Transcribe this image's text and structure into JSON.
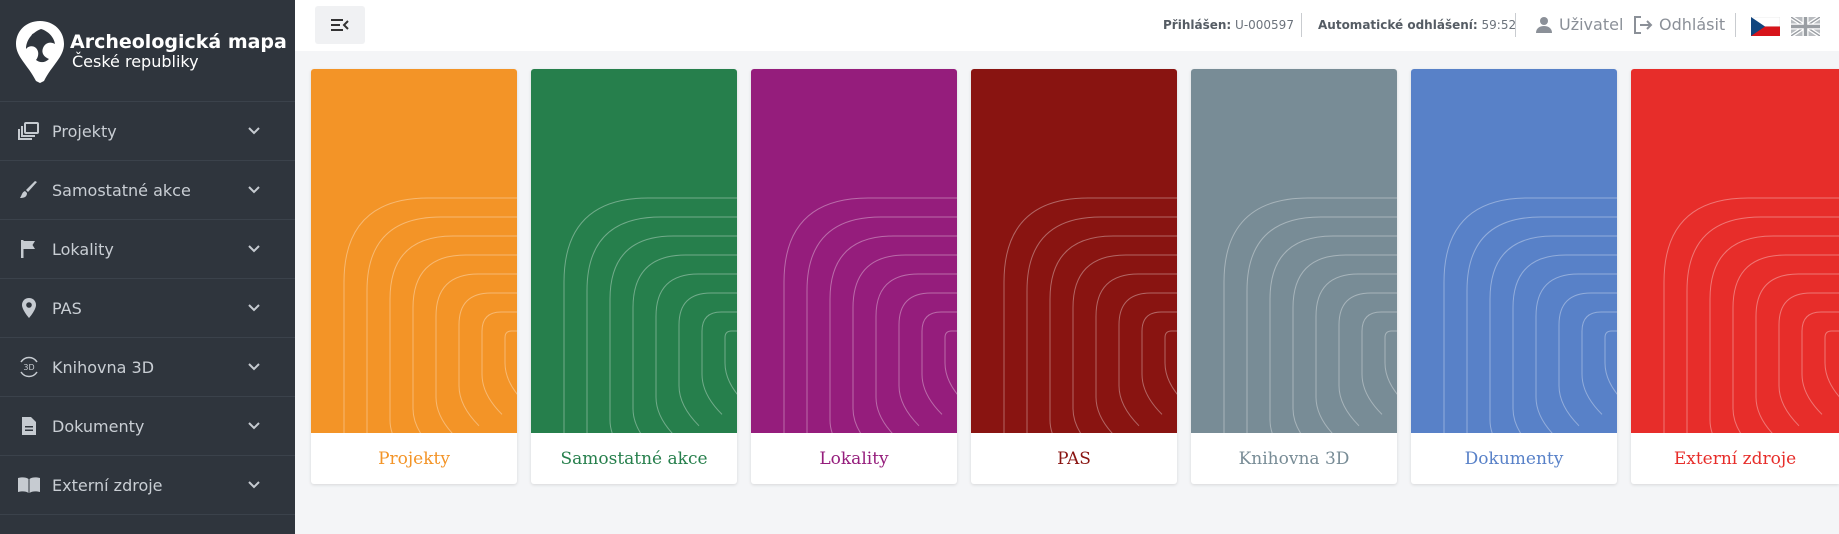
{
  "brand": {
    "title": "Archeologická mapa",
    "subtitle": "České republiky"
  },
  "sidebar": {
    "items": [
      {
        "label": "Projekty",
        "icon": "projects-icon"
      },
      {
        "label": "Samostatné akce",
        "icon": "brush-icon"
      },
      {
        "label": "Lokality",
        "icon": "flag-icon"
      },
      {
        "label": "PAS",
        "icon": "map-pin-icon"
      },
      {
        "label": "Knihovna 3D",
        "icon": "3d-rotate-icon"
      },
      {
        "label": "Dokumenty",
        "icon": "document-icon"
      },
      {
        "label": "Externí zdroje",
        "icon": "book-icon"
      }
    ]
  },
  "header": {
    "logged_in_label": "Přihlášen:",
    "logged_in_value": "U-000597",
    "auto_logout_label": "Automatické odhlášení:",
    "auto_logout_value": "59:52",
    "user_label": "Uživatel",
    "logout_label": "Odhlásit"
  },
  "tiles": [
    {
      "label": "Projekty",
      "color": "#f39427"
    },
    {
      "label": "Samostatné akce",
      "color": "#267f4c"
    },
    {
      "label": "Lokality",
      "color": "#951d7c"
    },
    {
      "label": "PAS",
      "color": "#891411"
    },
    {
      "label": "Knihovna 3D",
      "color": "#788c96"
    },
    {
      "label": "Dokumenty",
      "color": "#5881c8"
    },
    {
      "label": "Externí zdroje",
      "color": "#e72d2a"
    }
  ]
}
